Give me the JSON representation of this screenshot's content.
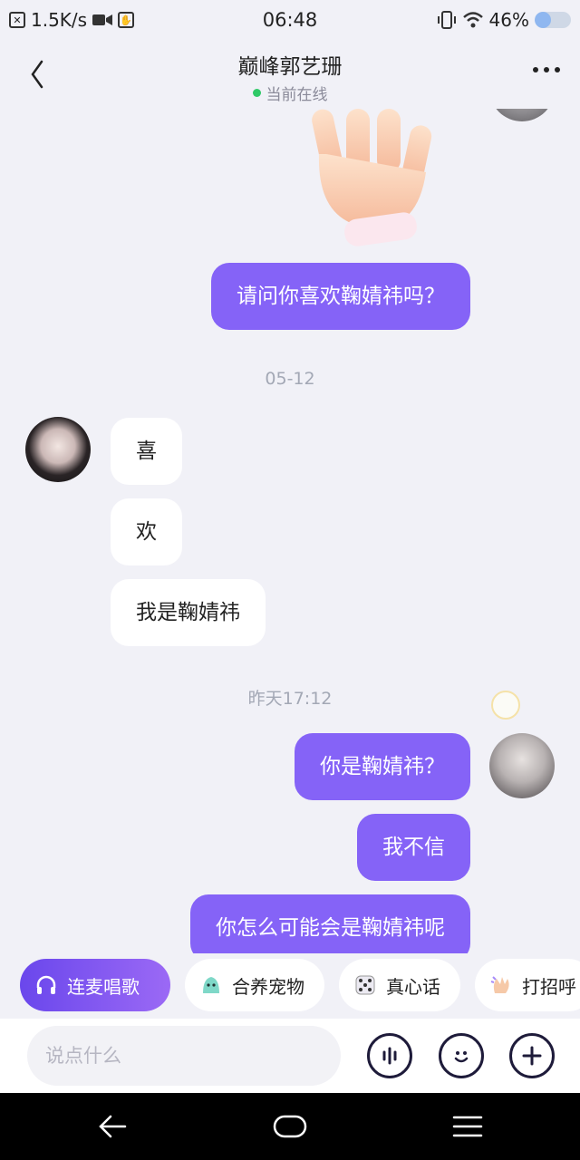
{
  "status_bar": {
    "network_speed": "1.5K/s",
    "time": "06:48",
    "battery_percent": "46%",
    "battery_level": 0.46
  },
  "header": {
    "title": "巅峰郭艺珊",
    "status": "当前在线",
    "status_color": "#2fc967"
  },
  "messages": [
    {
      "type": "sticker",
      "side": "out",
      "name": "waving-hand-sticker"
    },
    {
      "type": "text",
      "side": "out",
      "text": "请问你喜欢鞠婧祎吗？"
    },
    {
      "type": "time",
      "text": "05-12"
    },
    {
      "type": "text",
      "side": "in",
      "text": "喜"
    },
    {
      "type": "text",
      "side": "in",
      "text": "欢"
    },
    {
      "type": "text",
      "side": "in",
      "text": "我是鞠婧祎"
    },
    {
      "type": "time",
      "text": "昨天17:12"
    },
    {
      "type": "text",
      "side": "out",
      "text": "你是鞠婧祎？"
    },
    {
      "type": "text",
      "side": "out",
      "text": "我不信"
    },
    {
      "type": "text",
      "side": "out",
      "text": "你怎么可能会是鞠婧祎呢"
    }
  ],
  "quick_actions": [
    {
      "label": "连麦唱歌",
      "icon": "headphones-icon"
    },
    {
      "label": "合养宠物",
      "icon": "pet-icon"
    },
    {
      "label": "真心话",
      "icon": "dice-icon"
    },
    {
      "label": "打招呼",
      "icon": "wave-icon"
    }
  ],
  "input": {
    "placeholder": "说点什么",
    "value": ""
  },
  "colors": {
    "accent": "#8563f7",
    "background": "#f1f1f7"
  }
}
